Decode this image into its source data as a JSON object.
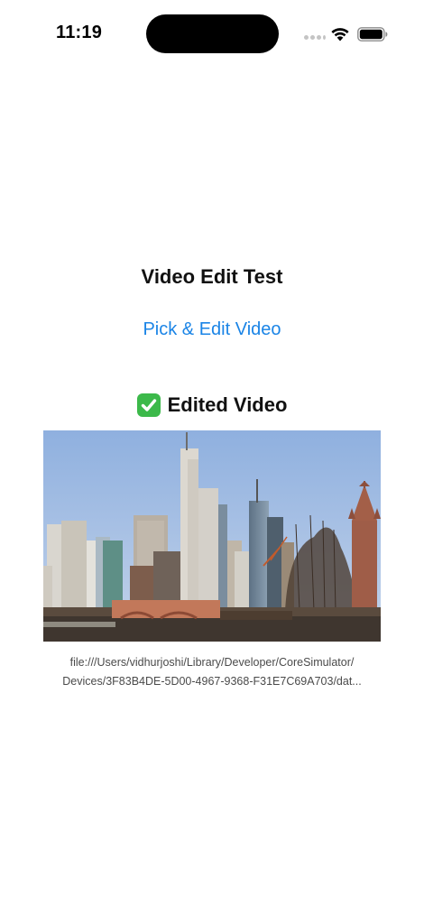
{
  "status_bar": {
    "time": "11:19",
    "icons": [
      "signal-icon",
      "wifi-icon",
      "battery-icon"
    ]
  },
  "main": {
    "title": "Video Edit Test",
    "pick_button_label": "Pick & Edit Video",
    "edited_heading": {
      "icon": "check-mark-icon",
      "label": "Edited Video"
    },
    "video": {
      "subject": "city skyline video thumbnail"
    },
    "file_path_lines": [
      "file:///Users/vidhurjoshi/Library/Developer/CoreSimulator/",
      "Devices/3F83B4DE-5D00-4967-9368-F31E7C69A703/dat..."
    ]
  },
  "colors": {
    "accent": "#1a84e6",
    "check": "#3cb94a",
    "sky": "#a9c2e3"
  }
}
